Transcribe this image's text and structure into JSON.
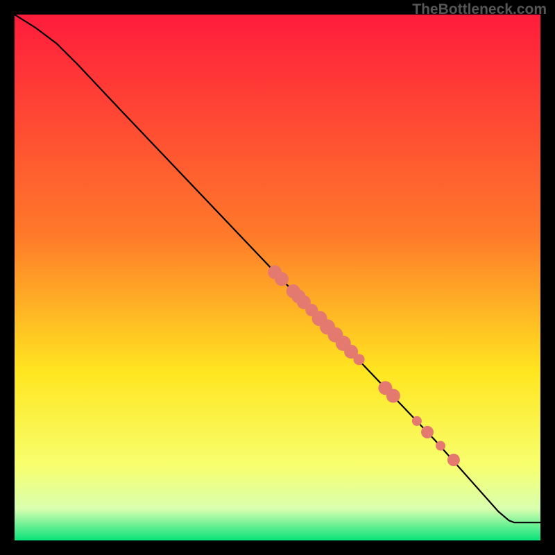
{
  "watermark": "TheBottleneck.com",
  "colors": {
    "gradient_top": "#ff1c3c",
    "gradient_mid1": "#ff7a2a",
    "gradient_mid2": "#ffe620",
    "gradient_mid3": "#f7ff6f",
    "gradient_mid4": "#d9ffb0",
    "gradient_bottom": "#08e27a",
    "line": "#000000",
    "dot_fill": "#e47a6f",
    "dot_stroke": "#c64f46"
  },
  "chart_data": {
    "type": "line",
    "title": "",
    "xlabel": "",
    "ylabel": "",
    "xlim": [
      0,
      100
    ],
    "ylim": [
      0,
      100
    ],
    "curve": [
      {
        "x": 0,
        "y": 100
      },
      {
        "x": 4,
        "y": 97.5
      },
      {
        "x": 8,
        "y": 94.5
      },
      {
        "x": 12,
        "y": 90.5
      },
      {
        "x": 20,
        "y": 82
      },
      {
        "x": 30,
        "y": 71.5
      },
      {
        "x": 40,
        "y": 61
      },
      {
        "x": 50,
        "y": 50.5
      },
      {
        "x": 60,
        "y": 40
      },
      {
        "x": 70,
        "y": 29.5
      },
      {
        "x": 80,
        "y": 19
      },
      {
        "x": 88,
        "y": 10
      },
      {
        "x": 92,
        "y": 5.5
      },
      {
        "x": 94,
        "y": 3.8
      },
      {
        "x": 95,
        "y": 3.4
      },
      {
        "x": 100,
        "y": 3.4
      }
    ],
    "points": [
      {
        "x": 49.5,
        "y": 51.0,
        "r": 10
      },
      {
        "x": 50.8,
        "y": 49.7,
        "r": 10
      },
      {
        "x": 53.0,
        "y": 47.4,
        "r": 10
      },
      {
        "x": 54.0,
        "y": 46.4,
        "r": 10
      },
      {
        "x": 55.0,
        "y": 45.3,
        "r": 10
      },
      {
        "x": 56.5,
        "y": 43.8,
        "r": 9
      },
      {
        "x": 58.0,
        "y": 42.2,
        "r": 11
      },
      {
        "x": 59.5,
        "y": 40.6,
        "r": 11
      },
      {
        "x": 61.0,
        "y": 39.1,
        "r": 11
      },
      {
        "x": 62.5,
        "y": 37.5,
        "r": 11
      },
      {
        "x": 64.0,
        "y": 35.9,
        "r": 10
      },
      {
        "x": 65.5,
        "y": 34.4,
        "r": 8
      },
      {
        "x": 70.5,
        "y": 29.0,
        "r": 10
      },
      {
        "x": 72.0,
        "y": 27.5,
        "r": 10
      },
      {
        "x": 76.5,
        "y": 22.7,
        "r": 7
      },
      {
        "x": 78.5,
        "y": 20.6,
        "r": 9
      },
      {
        "x": 81.0,
        "y": 18.0,
        "r": 7
      },
      {
        "x": 83.5,
        "y": 15.3,
        "r": 9
      }
    ],
    "color_bands": [
      {
        "value": 100,
        "color": "red"
      },
      {
        "value": 50,
        "color": "yellow"
      },
      {
        "value": 3,
        "color": "green"
      }
    ]
  }
}
